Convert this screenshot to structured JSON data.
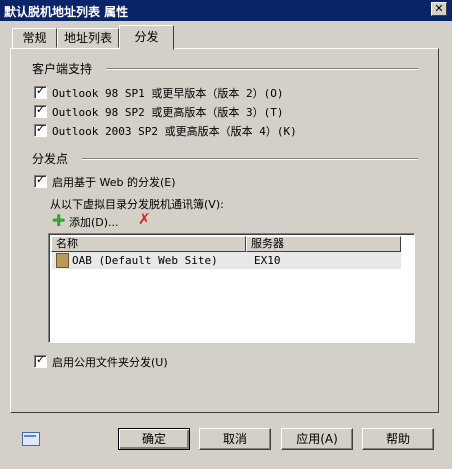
{
  "window": {
    "title": "默认脱机地址列表 属性"
  },
  "tabs": [
    {
      "label": "常规"
    },
    {
      "label": "地址列表"
    },
    {
      "label": "分发"
    }
  ],
  "client_support": {
    "heading": "客户端支持",
    "options": [
      {
        "label": "Outlook 98 SP1 或更早版本（版本 2）(O)",
        "checked": true
      },
      {
        "label": "Outlook 98 SP2 或更高版本（版本 3）(T)",
        "checked": true
      },
      {
        "label": "Outlook 2003 SP2 或更高版本（版本 4）(K)",
        "checked": true
      }
    ]
  },
  "distribution": {
    "heading": "分发点",
    "web_checkbox": {
      "label": "启用基于 Web 的分发(E)",
      "checked": true
    },
    "vdir_label": "从以下虚拟目录分发脱机通讯簿(V):",
    "add_label": "添加(D)...",
    "columns": [
      "名称",
      "服务器"
    ],
    "rows": [
      {
        "name": "OAB (Default Web Site)",
        "server": "EX10"
      }
    ],
    "public_folder_checkbox": {
      "label": "启用公用文件夹分发(U)",
      "checked": true
    }
  },
  "buttons": {
    "ok": "确定",
    "cancel": "取消",
    "apply": "应用(A)",
    "help": "帮助"
  },
  "colors": {
    "titlebar": "#0a246a",
    "face": "#d4d0c8"
  }
}
